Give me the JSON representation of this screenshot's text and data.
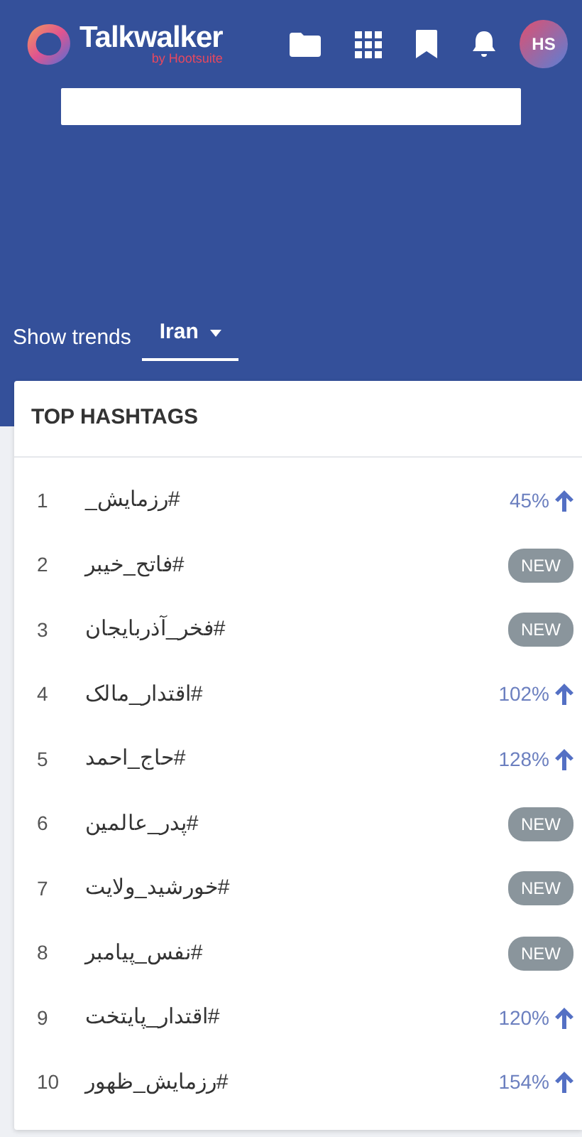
{
  "header": {
    "brand": "Talkwalker",
    "brand_sub": "by Hootsuite",
    "avatar": "HS"
  },
  "filter": {
    "label": "Show trends",
    "value": "Iran"
  },
  "top_hashtags": {
    "title": "TOP HASHTAGS",
    "rows": [
      {
        "rank": "1",
        "tag": "#رزمایش_",
        "kind": "percent",
        "trend": "45%"
      },
      {
        "rank": "2",
        "tag": "#فاتح_خیبر",
        "kind": "new",
        "trend": "NEW"
      },
      {
        "rank": "3",
        "tag": "#فخر_آذربایجان",
        "kind": "new",
        "trend": "NEW"
      },
      {
        "rank": "4",
        "tag": "#اقتدار_مالک",
        "kind": "percent",
        "trend": "102%"
      },
      {
        "rank": "5",
        "tag": "#حاج_احمد",
        "kind": "percent",
        "trend": "128%"
      },
      {
        "rank": "6",
        "tag": "#پدر_عالمین",
        "kind": "new",
        "trend": "NEW"
      },
      {
        "rank": "7",
        "tag": "#خورشید_ولایت",
        "kind": "new",
        "trend": "NEW"
      },
      {
        "rank": "8",
        "tag": "#نفس_پیامبر",
        "kind": "new",
        "trend": "NEW"
      },
      {
        "rank": "9",
        "tag": "#اقتدار_پایتخت",
        "kind": "percent",
        "trend": "120%"
      },
      {
        "rank": "10",
        "tag": "#رزمایش_ظهور",
        "kind": "percent",
        "trend": "154%"
      }
    ]
  }
}
